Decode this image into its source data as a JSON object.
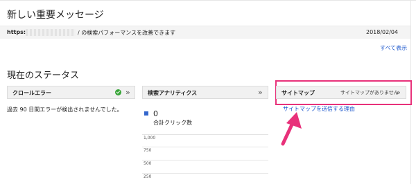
{
  "messages": {
    "title": "新しい重要メッセージ",
    "item": {
      "url_prefix": "https://",
      "url_suffix": "/ の検索パフォーマンスを改善できます",
      "date": "2018/02/04"
    },
    "see_all": "すべて表示"
  },
  "status": {
    "title": "現在のステータス",
    "crawl": {
      "title": "クロールエラー",
      "note": "過去 90 日間エラーが検出されませんでした。"
    },
    "analytics": {
      "title": "検索アナリティクス",
      "clicks_value": "0",
      "clicks_label": "合計クリック数",
      "ticks": [
        "1,000",
        "750",
        "500",
        "250"
      ]
    },
    "sitemap": {
      "title": "サイトマップ",
      "status": "サイトマップがありません",
      "submit_link": "サイトマップを送信する理由"
    }
  },
  "icons": {
    "chevron": "»",
    "ok": "check-circle-icon"
  },
  "colors": {
    "link": "#1a55cc",
    "highlight": "#e8317a",
    "ok": "#3aa53a",
    "series": "#3366cc"
  }
}
